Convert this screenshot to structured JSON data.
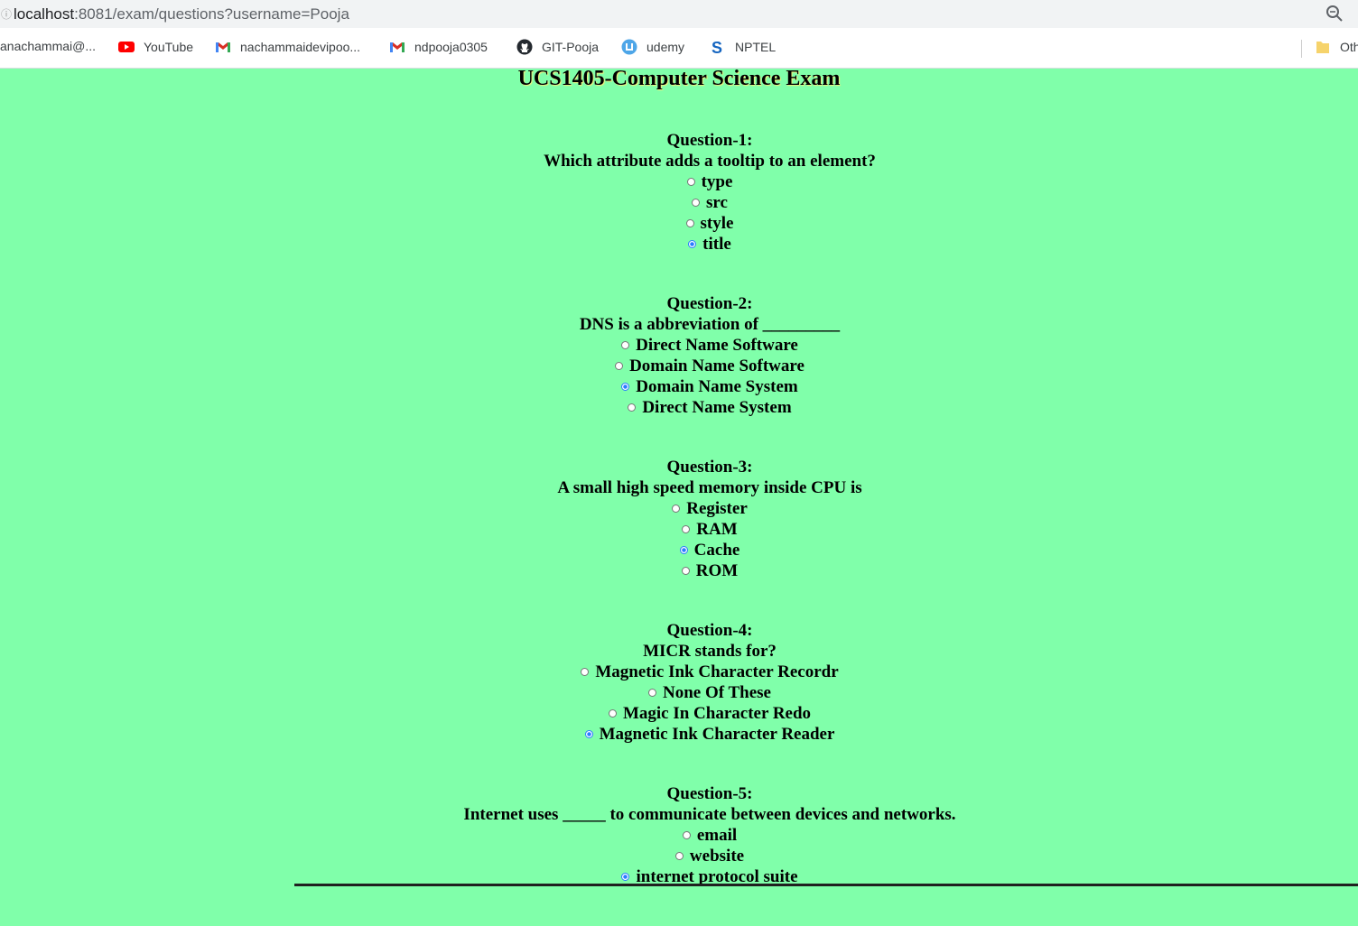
{
  "browser": {
    "url_host": "localhost",
    "url_rest": ":8081/exam/questions?username=Pooja",
    "bookmarks": [
      {
        "label": "anachammai@...",
        "icon": "none"
      },
      {
        "label": "YouTube",
        "icon": "youtube-icon"
      },
      {
        "label": "nachammaidevipoo...",
        "icon": "gmail-icon"
      },
      {
        "label": "ndpooja0305",
        "icon": "gmail-icon"
      },
      {
        "label": "GIT-Pooja",
        "icon": "github-icon"
      },
      {
        "label": "udemy",
        "icon": "udemy-icon"
      },
      {
        "label": "NPTEL",
        "icon": "nptel-icon"
      },
      {
        "label": "Oth",
        "icon": "folder-icon"
      }
    ],
    "colors": {
      "youtube": "#ff0000",
      "gmail": "#d93025",
      "udemy": "#4ea6e8",
      "nptel": "#1565c0",
      "folder": "#f6d36b"
    }
  },
  "page": {
    "title": "UCS1405-Computer Science Exam",
    "background": "#80ffaa"
  },
  "questions": [
    {
      "head": "Question-1:",
      "text": "Which attribute adds a tooltip to an element?",
      "options": [
        "type",
        "src",
        "style",
        "title"
      ],
      "selected": 3
    },
    {
      "head": "Question-2:",
      "text": "DNS is a abbreviation of _________",
      "options": [
        "Direct Name Software",
        "Domain Name Software",
        "Domain Name System",
        "Direct Name System"
      ],
      "selected": 2
    },
    {
      "head": "Question-3:",
      "text": "A small high speed memory inside CPU is",
      "options": [
        "Register",
        "RAM",
        "Cache",
        "ROM"
      ],
      "selected": 2
    },
    {
      "head": "Question-4:",
      "text": "MICR stands for?",
      "options": [
        "Magnetic Ink Character Recordr",
        "None Of These",
        "Magic In Character Redo",
        "Magnetic Ink Character Reader"
      ],
      "selected": 3
    },
    {
      "head": "Question-5:",
      "text": "Internet uses _____ to communicate between devices and networks.",
      "options": [
        "email",
        "website",
        "internet protocol suite"
      ],
      "selected": 2
    }
  ]
}
